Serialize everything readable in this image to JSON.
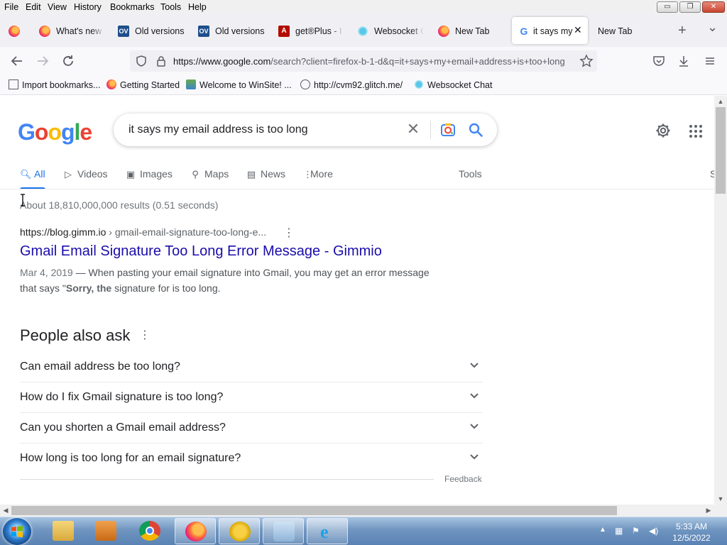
{
  "menubar": {
    "items": [
      "File",
      "Edit",
      "View",
      "History",
      "Bookmarks",
      "Tools",
      "Help"
    ],
    "window_controls": {
      "minimize": "▭",
      "restore": "❐",
      "close": "✕"
    }
  },
  "tabs": [
    {
      "label": "",
      "icon": "firefox-icon"
    },
    {
      "label": "What's new",
      "icon": "firefox-icon"
    },
    {
      "label": "Old versions",
      "icon": "oldversion-icon"
    },
    {
      "label": "Old versions",
      "icon": "oldversion-icon"
    },
    {
      "label": "get®Plus - I",
      "icon": "adobe-icon"
    },
    {
      "label": "Websocket C",
      "icon": "websocket-icon"
    },
    {
      "label": "New Tab",
      "icon": "firefox-icon"
    },
    {
      "label": "it says my",
      "icon": "google-icon",
      "active": true
    },
    {
      "label": "New Tab",
      "icon": ""
    }
  ],
  "tabstrip_buttons": {
    "new_tab": "+",
    "list_all": "⌄"
  },
  "navbar": {
    "url_host": "https://www.google.com",
    "url_rest": "/search?client=firefox-b-1-d&q=it+says+my+email+address+is+too+long"
  },
  "bookmarks": [
    {
      "label": "Import bookmarks...",
      "icon": "import-icon"
    },
    {
      "label": "Getting Started",
      "icon": "firefox-icon"
    },
    {
      "label": "Welcome to WinSite! ...",
      "icon": "winsite-icon"
    },
    {
      "label": "http://cvm92.glitch.me/",
      "icon": "globe-icon"
    },
    {
      "label": "Websocket Chat",
      "icon": "websocket-icon"
    }
  ],
  "google": {
    "logo_letters": [
      "G",
      "o",
      "o",
      "g",
      "l",
      "e"
    ],
    "query": "it says my email address is too long",
    "tabs": [
      "All",
      "Videos",
      "Images",
      "Maps",
      "News",
      "More"
    ],
    "tools_label": "Tools",
    "cut_off_label": "S",
    "result_stats": "About 18,810,000,000 results (0.51 seconds)",
    "result": {
      "cite_host": "https://blog.gimm.io",
      "cite_path": " › gmail-email-signature-too-long-e...",
      "title": "Gmail Email Signature Too Long Error Message - Gimmio",
      "date": "Mar 4, 2019",
      "snippet_part1": " — When pasting your email signature into Gmail, you may get an error message that says \"",
      "snippet_bold": "Sorry, the",
      "snippet_part2": " signature for is too long."
    },
    "people_also_ask": {
      "heading": "People also ask",
      "questions": [
        "Can email address be too long?",
        "How do I fix Gmail signature is too long?",
        "Can you shorten a Gmail email address?",
        "How long is too long for an email signature?"
      ],
      "feedback": "Feedback"
    }
  },
  "taskbar": {
    "time": "5:33 AM",
    "date": "12/5/2022",
    "apps": [
      "explorer-icon",
      "media-player-icon",
      "chrome-icon",
      "firefox-icon",
      "stethoscope-icon",
      "notepad-icon",
      "internet-explorer-icon"
    ]
  },
  "colors": {
    "link": "#1a0dab",
    "accent": "#1a73e8",
    "taskbar": "#5a82b3"
  }
}
